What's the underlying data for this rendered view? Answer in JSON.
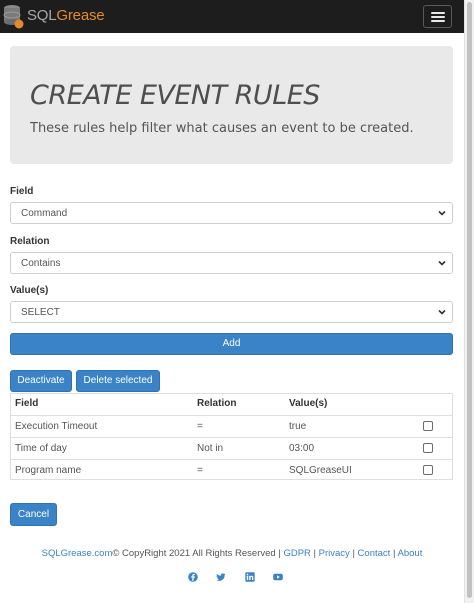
{
  "navbar": {
    "brand_part1": "SQL",
    "brand_part2": "Grease",
    "menu_icon": "hamburger-icon"
  },
  "jumbotron": {
    "title": "CREATE EVENT RULES",
    "subtitle": "These rules help filter what causes an event to be created."
  },
  "form": {
    "field_label": "Field",
    "field_value": "Command",
    "relation_label": "Relation",
    "relation_value": "Contains",
    "values_label": "Value(s)",
    "values_value": "SELECT",
    "add_label": "Add"
  },
  "actions": {
    "deactivate_label": "Deactivate",
    "delete_label": "Delete selected",
    "cancel_label": "Cancel"
  },
  "table": {
    "headers": [
      "Field",
      "Relation",
      "Value(s)"
    ],
    "rows": [
      {
        "field": "Execution Timeout",
        "relation": "=",
        "value": "true",
        "checked": false
      },
      {
        "field": "Time of day",
        "relation": "Not in",
        "value": "03:00",
        "checked": false
      },
      {
        "field": "Program name",
        "relation": "=",
        "value": "SQLGreaseUI",
        "checked": false
      }
    ]
  },
  "footer": {
    "brand_link": "SQLGrease.com",
    "copyright": "© CopyRight 2021 All Rights Reserved |",
    "gdpr": "GDPR",
    "sep": "|",
    "privacy": "Privacy",
    "contact": "Contact",
    "about": "About",
    "social_icons": [
      "facebook-icon",
      "twitter-icon",
      "linkedin-icon",
      "youtube-icon"
    ]
  },
  "colors": {
    "navbar_bg": "#1d1d1d",
    "brand_orange": "#e58a2c",
    "primary_button": "#3a83c6",
    "link": "#3a83c6",
    "jumbotron_bg": "#e9e9e9"
  }
}
